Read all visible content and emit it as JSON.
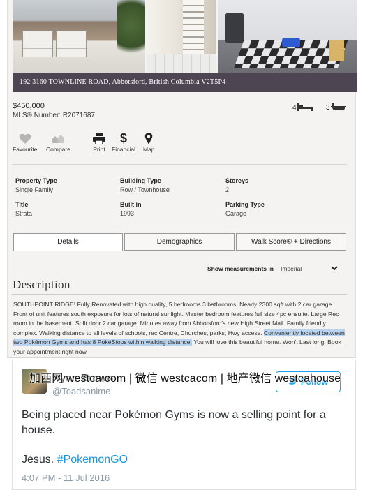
{
  "listing": {
    "address": "192 3160 TOWNLINE ROAD, Abbotsford, British Columbia   V2T5P4",
    "price": "$450,000",
    "mls": "MLS® Number: R2071687",
    "beds": "4",
    "baths": "3",
    "actions": [
      {
        "label": "Favourite",
        "icon": "heart-icon"
      },
      {
        "label": "Compare",
        "icon": "compare-icon"
      },
      {
        "label": "Print",
        "icon": "print-icon"
      },
      {
        "label": "Financial",
        "icon": "dollar-icon"
      },
      {
        "label": "Map",
        "icon": "map-pin-icon"
      }
    ],
    "details": [
      {
        "key": "Property Type",
        "value": "Single Family"
      },
      {
        "key": "Building Type",
        "value": "Row / Townhouse"
      },
      {
        "key": "Storeys",
        "value": "2"
      },
      {
        "key": "Title",
        "value": "Strata"
      },
      {
        "key": "Built in",
        "value": "1993"
      },
      {
        "key": "Parking Type",
        "value": "Garage"
      }
    ],
    "tabs": [
      {
        "label": "Details",
        "active": true
      },
      {
        "label": "Demographics",
        "active": false
      },
      {
        "label": "Walk Score® + Directions",
        "active": false
      }
    ],
    "measurements": {
      "label": "Show measurements in",
      "value": "Imperial"
    },
    "description": {
      "title": "Description",
      "text_before": "SOUTHPOINT RIDGE! Fully Renovated with high quality, 5 bedrooms 3 bathrooms. Nearly 2300 sqft with 2 car garage. Front of unit features south exposure for lots of natural sunlight. Master bedroom features full size 4pc ensuite. Large Rec room in the basement. Split door 2 car garage. Minutes away from Abbotsford's new High Street Mall. Family friendly complex. Walking distance to all levels of schools, rec Centre, Churches, parks, Hwy access. ",
      "text_highlight": "Conveniently located between two Pokémon Gyms and has 8 PokéStops within walking distance.",
      "text_after": " You will love this beautiful home. Won't Last long. Book your appointment right now."
    }
  },
  "tweet": {
    "name": "Ryan Brown",
    "handle": "@Toadsanime",
    "follow_label": "Follow",
    "text": "Being placed near Pokémon Gyms is now a selling point for a house.",
    "text2_prefix": "Jesus. ",
    "hashtag": "#PokemonGO",
    "time": "4:07 PM - 11 Jul 2016"
  },
  "watermark": "加西网 westca.com | 微信 westcacom | 地产微信 westcahouse",
  "colors": {
    "address_bar": "#4e4553",
    "highlight": "#b9d3ee",
    "twitter_blue": "#1da1f2",
    "hashtag": "#1b95e0"
  }
}
